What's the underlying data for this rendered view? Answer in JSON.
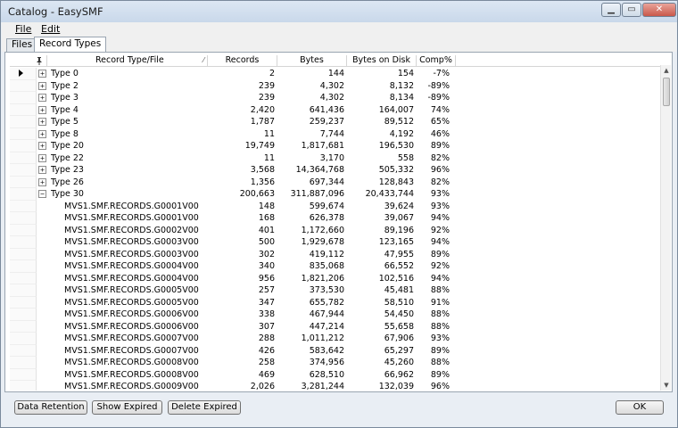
{
  "window": {
    "title": "Catalog - EasySMF"
  },
  "menu": [
    {
      "label": "File",
      "accel": "F"
    },
    {
      "label": "Edit",
      "accel": "E"
    }
  ],
  "tabs": [
    {
      "label": "Files",
      "active": false
    },
    {
      "label": "Record Types",
      "active": true
    }
  ],
  "table": {
    "columns": {
      "name": "Record Type/File",
      "records": "Records",
      "bytes": "Bytes",
      "disk": "Bytes on Disk",
      "comp": "Comp%"
    },
    "rows": [
      {
        "name": "Type 0",
        "records": "2",
        "bytes": "144",
        "disk": "154",
        "comp": "-7%",
        "group": true,
        "expanded": false,
        "selected": true
      },
      {
        "name": "Type 2",
        "records": "239",
        "bytes": "4,302",
        "disk": "8,132",
        "comp": "-89%",
        "group": true,
        "expanded": false
      },
      {
        "name": "Type 3",
        "records": "239",
        "bytes": "4,302",
        "disk": "8,134",
        "comp": "-89%",
        "group": true,
        "expanded": false
      },
      {
        "name": "Type 4",
        "records": "2,420",
        "bytes": "641,436",
        "disk": "164,007",
        "comp": "74%",
        "group": true,
        "expanded": false
      },
      {
        "name": "Type 5",
        "records": "1,787",
        "bytes": "259,237",
        "disk": "89,512",
        "comp": "65%",
        "group": true,
        "expanded": false
      },
      {
        "name": "Type 8",
        "records": "11",
        "bytes": "7,744",
        "disk": "4,192",
        "comp": "46%",
        "group": true,
        "expanded": false
      },
      {
        "name": "Type 20",
        "records": "19,749",
        "bytes": "1,817,681",
        "disk": "196,530",
        "comp": "89%",
        "group": true,
        "expanded": false
      },
      {
        "name": "Type 22",
        "records": "11",
        "bytes": "3,170",
        "disk": "558",
        "comp": "82%",
        "group": true,
        "expanded": false
      },
      {
        "name": "Type 23",
        "records": "3,568",
        "bytes": "14,364,768",
        "disk": "505,332",
        "comp": "96%",
        "group": true,
        "expanded": false
      },
      {
        "name": "Type 26",
        "records": "1,356",
        "bytes": "697,344",
        "disk": "128,843",
        "comp": "82%",
        "group": true,
        "expanded": false
      },
      {
        "name": "Type 30",
        "records": "200,663",
        "bytes": "311,887,096",
        "disk": "20,433,744",
        "comp": "93%",
        "group": true,
        "expanded": true
      },
      {
        "name": "MVS1.SMF.RECORDS.G0001V00",
        "records": "148",
        "bytes": "599,674",
        "disk": "39,624",
        "comp": "93%"
      },
      {
        "name": "MVS1.SMF.RECORDS.G0001V00",
        "records": "168",
        "bytes": "626,378",
        "disk": "39,067",
        "comp": "94%"
      },
      {
        "name": "MVS1.SMF.RECORDS.G0002V00",
        "records": "401",
        "bytes": "1,172,660",
        "disk": "89,196",
        "comp": "92%"
      },
      {
        "name": "MVS1.SMF.RECORDS.G0003V00",
        "records": "500",
        "bytes": "1,929,678",
        "disk": "123,165",
        "comp": "94%"
      },
      {
        "name": "MVS1.SMF.RECORDS.G0003V00",
        "records": "302",
        "bytes": "419,112",
        "disk": "47,955",
        "comp": "89%"
      },
      {
        "name": "MVS1.SMF.RECORDS.G0004V00",
        "records": "340",
        "bytes": "835,068",
        "disk": "66,552",
        "comp": "92%"
      },
      {
        "name": "MVS1.SMF.RECORDS.G0004V00",
        "records": "956",
        "bytes": "1,821,206",
        "disk": "102,516",
        "comp": "94%"
      },
      {
        "name": "MVS1.SMF.RECORDS.G0005V00",
        "records": "257",
        "bytes": "373,530",
        "disk": "45,481",
        "comp": "88%"
      },
      {
        "name": "MVS1.SMF.RECORDS.G0005V00",
        "records": "347",
        "bytes": "655,782",
        "disk": "58,510",
        "comp": "91%"
      },
      {
        "name": "MVS1.SMF.RECORDS.G0006V00",
        "records": "338",
        "bytes": "467,944",
        "disk": "54,450",
        "comp": "88%"
      },
      {
        "name": "MVS1.SMF.RECORDS.G0006V00",
        "records": "307",
        "bytes": "447,214",
        "disk": "55,658",
        "comp": "88%"
      },
      {
        "name": "MVS1.SMF.RECORDS.G0007V00",
        "records": "288",
        "bytes": "1,011,212",
        "disk": "67,906",
        "comp": "93%"
      },
      {
        "name": "MVS1.SMF.RECORDS.G0007V00",
        "records": "426",
        "bytes": "583,642",
        "disk": "65,297",
        "comp": "89%"
      },
      {
        "name": "MVS1.SMF.RECORDS.G0008V00",
        "records": "258",
        "bytes": "374,956",
        "disk": "45,260",
        "comp": "88%"
      },
      {
        "name": "MVS1.SMF.RECORDS.G0008V00",
        "records": "469",
        "bytes": "628,510",
        "disk": "66,962",
        "comp": "89%"
      },
      {
        "name": "MVS1.SMF.RECORDS.G0009V00",
        "records": "2,026",
        "bytes": "3,281,244",
        "disk": "132,039",
        "comp": "96%"
      }
    ]
  },
  "buttons": {
    "data_retention": "Data Retention",
    "show_expired": "Show Expired",
    "delete_expired": "Delete Expired",
    "ok": "OK"
  },
  "icons": {
    "sort": "pin-icon",
    "sort_direction": "sort-indicator-icon",
    "expand": "plus-box-icon",
    "collapse": "minus-box-icon",
    "selected_row": "row-pointer-icon"
  },
  "colors": {
    "titlebar": "#c9d8ea",
    "close_button": "#c9584a",
    "grid_background": "#ffffff"
  }
}
